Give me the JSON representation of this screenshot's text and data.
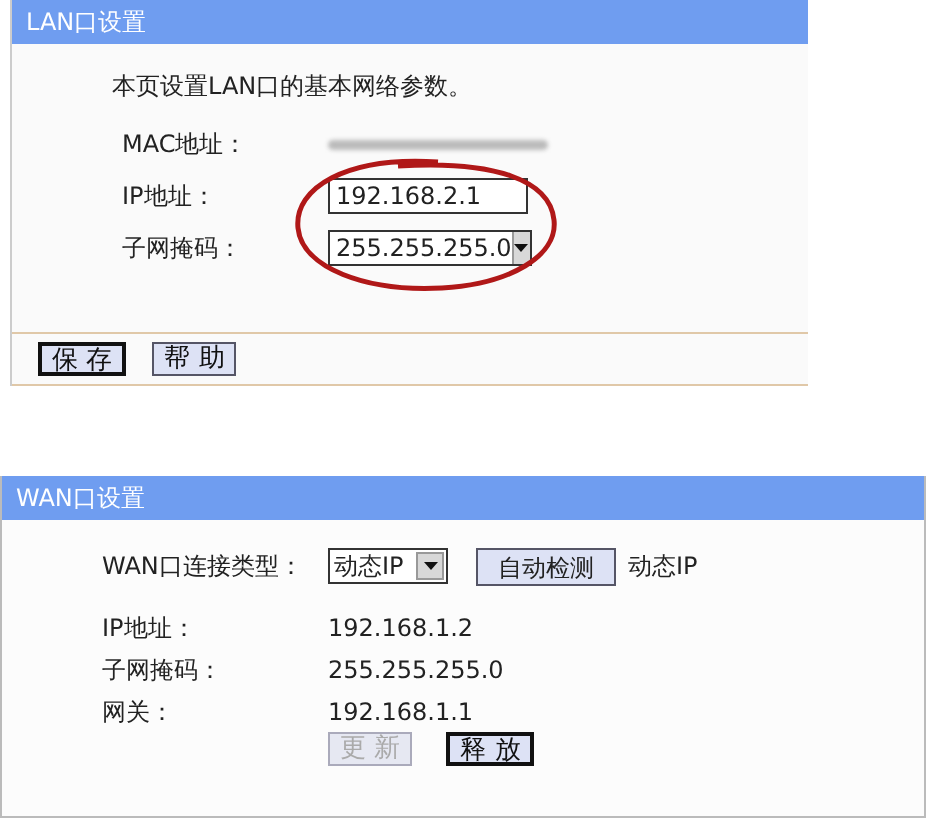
{
  "lan": {
    "title": "LAN口设置",
    "intro": "本页设置LAN口的基本网络参数。",
    "fields": [
      {
        "kind": "redacted",
        "label": "MAC地址："
      },
      {
        "kind": "input",
        "label": "IP地址：",
        "value": "192.168.2.1"
      },
      {
        "kind": "select",
        "label": "子网掩码：",
        "value": "255.255.255.0"
      }
    ],
    "circled": true,
    "buttons": [
      {
        "label": "保 存",
        "default": true,
        "disabled": false
      },
      {
        "label": "帮 助",
        "default": false,
        "disabled": false
      }
    ]
  },
  "wan": {
    "title": "WAN口设置",
    "type_label": "WAN口连接类型：",
    "type_value": "动态IP",
    "detect_button": "自动检测",
    "detected": "动态IP",
    "rows": [
      {
        "label": "IP地址：",
        "value": "192.168.1.2"
      },
      {
        "label": "子网掩码：",
        "value": "255.255.255.0"
      },
      {
        "label": "网关：",
        "value": "192.168.1.1"
      }
    ],
    "buttons": [
      {
        "label": "更 新",
        "default": false,
        "disabled": true
      },
      {
        "label": "释 放",
        "default": true,
        "disabled": false
      }
    ]
  }
}
